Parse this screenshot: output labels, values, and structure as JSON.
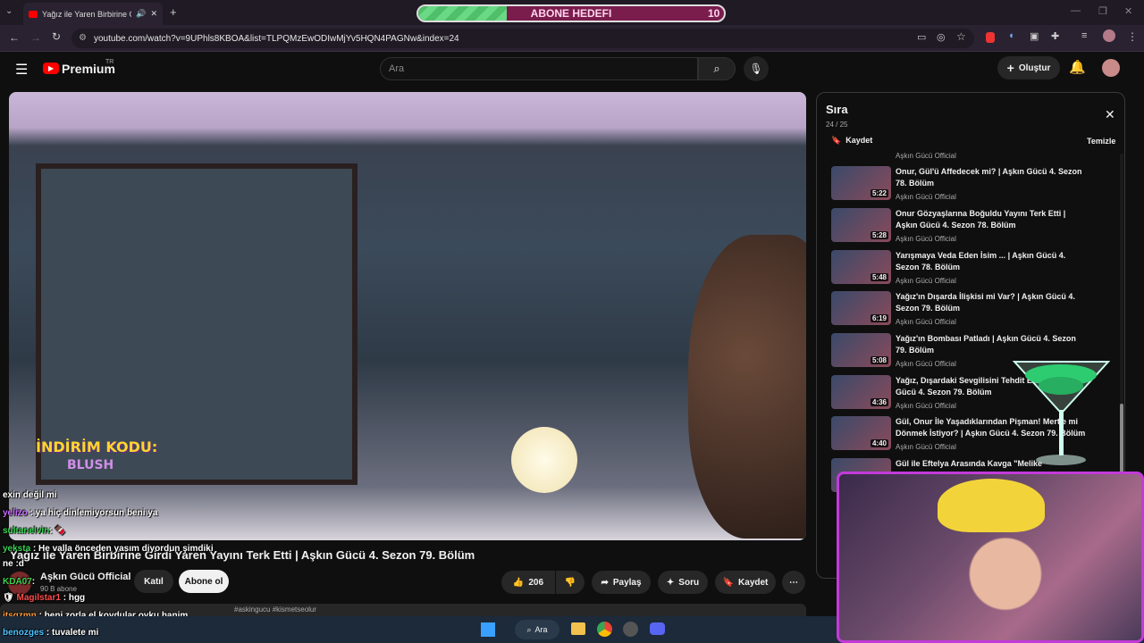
{
  "browser": {
    "tab_title": "Yağız ile Yaren Birbirine Gir",
    "url": "youtube.com/watch?v=9UPhls8KBOA&list=TLPQMzEwODIwMjYv5HQN4PAGNw&index=24"
  },
  "goal_overlay": {
    "label": "ABONE HEDEFI",
    "count": "10",
    "progress": 0.29
  },
  "header": {
    "logo": "Premium",
    "region": "TR",
    "search_placeholder": "Ara",
    "create_label": "Oluştur"
  },
  "video": {
    "title": "Yağız ile Yaren Birbirine Girdi Yaren Yayını Terk Etti | Aşkın Gücü 4. Sezon 79. Bölüm",
    "promo_line1": "İNDİRİM KODU:",
    "promo_line2": "BLUSH",
    "channel": "Aşkın Gücü Official",
    "subs": "90 B abone",
    "join": "Katıl",
    "subscribe": "Abone ol",
    "likes": "206",
    "share": "Paylaş",
    "ask": "Soru",
    "save": "Kaydet",
    "hashtags": "#askingucu #kismetseolur"
  },
  "queue": {
    "title": "Sıra",
    "position": "24 / 25",
    "save": "Kaydet",
    "clear": "Temizle",
    "top_channel": "Aşkın Gücü Official",
    "items": [
      {
        "title": "Onur, Gül'ü Affedecek mi? | Aşkın Gücü 4. Sezon 78. Bölüm",
        "channel": "Aşkın Gücü Official",
        "duration": "5:22"
      },
      {
        "title": "Onur Gözyaşlarına Boğuldu Yayını Terk Etti | Aşkın Gücü 4. Sezon 78. Bölüm",
        "channel": "Aşkın Gücü Official",
        "duration": "5:28"
      },
      {
        "title": "Yarışmaya Veda Eden İsim ... | Aşkın Gücü 4. Sezon 78. Bölüm",
        "channel": "Aşkın Gücü Official",
        "duration": "5:48"
      },
      {
        "title": "Yağız'ın Dışarda İlişkisi mi Var? | Aşkın Gücü 4. Sezon 79. Bölüm",
        "channel": "Aşkın Gücü Official",
        "duration": "6:19"
      },
      {
        "title": "Yağız'ın Bombası Patladı | Aşkın Gücü 4. Sezon 79. Bölüm",
        "channel": "Aşkın Gücü Official",
        "duration": "5:08"
      },
      {
        "title": "Yağız, Dışardaki Sevgilisini Tehdit Etti | Aşkın Gücü 4. Sezon 79. Bölüm",
        "channel": "Aşkın Gücü Official",
        "duration": "4:36"
      },
      {
        "title": "Gül, Onur İle Yaşadıklarından Pişman! Mert'e mi Dönmek İstiyor? | Aşkın Gücü 4. Sezon 79. Bölüm",
        "channel": "Aşkın Gücü Official",
        "duration": "4:40"
      },
      {
        "title": "Gül ile Eftelya Arasında Kavga \"Melike",
        "channel": "",
        "duration": ""
      }
    ]
  },
  "chat": [
    {
      "user": "",
      "text": "exin değil mi",
      "color": "#ffffff"
    },
    {
      "user": "yelizo",
      "text": ": ya hiç dinlemiyorsun beni ya",
      "color": "#c86bff"
    },
    {
      "user": "sultanelvin",
      "text": ":",
      "color": "#39d353"
    },
    {
      "user": "yeksta",
      "text": ": He valla önceden yasım diyordun şimdiki",
      "color": "#39d353"
    },
    {
      "user": "",
      "text": "ne :d",
      "color": "#ffffff"
    },
    {
      "user": "KDA07",
      "text": ":",
      "color": "#39d353"
    },
    {
      "user": "Magilstar1",
      "text": ": hgg",
      "color": "#ff4d4d"
    },
    {
      "user": "itsgzmn",
      "text": ": beni zorla el koydular oyku hanim",
      "color": "#ff9a3c"
    },
    {
      "user": "benozges",
      "text": ": tuvalete mi",
      "color": "#4dc3ff"
    }
  ],
  "taskbar": {
    "search_label": "Ara"
  },
  "colors": {
    "accent": "#ff0000",
    "cam_border": "#c23bd8"
  }
}
